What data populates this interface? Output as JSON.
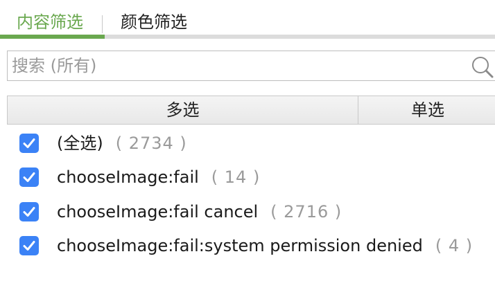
{
  "tabs": [
    {
      "label": "内容筛选",
      "active": true
    },
    {
      "label": "颜色筛选",
      "active": false
    }
  ],
  "accent_color": "#6aa84f",
  "checkbox_color": "#3b82f6",
  "search": {
    "placeholder": "搜索 (所有)",
    "value": "",
    "icon": "search-icon"
  },
  "columns": [
    {
      "label": "多选"
    },
    {
      "label": "单选"
    }
  ],
  "items": [
    {
      "label": "(全选)",
      "count": "( 2734 )",
      "checked": true
    },
    {
      "label": "chooseImage:fail",
      "count": "( 14 )",
      "checked": true
    },
    {
      "label": "chooseImage:fail cancel",
      "count": "( 2716 )",
      "checked": true
    },
    {
      "label": "chooseImage:fail:system permission denied",
      "count": "( 4 )",
      "checked": true
    }
  ]
}
